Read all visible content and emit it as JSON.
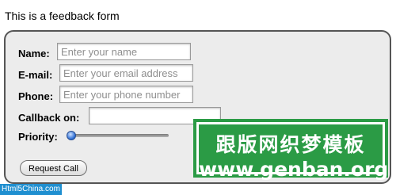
{
  "intro_text": "This is a feedback form",
  "form": {
    "fields": {
      "name": {
        "label": "Name:",
        "placeholder": "Enter your name",
        "value": ""
      },
      "email": {
        "label": "E-mail:",
        "placeholder": "Enter your email address",
        "value": ""
      },
      "phone": {
        "label": "Phone:",
        "placeholder": "Enter your phone number",
        "value": ""
      },
      "callback": {
        "label": "Callback on:",
        "value": ""
      }
    },
    "priority": {
      "label": "Priority:",
      "level": 0
    },
    "submit_label": "Request Call"
  },
  "watermark": {
    "chinese": "跟版网织梦模板",
    "url": "www.genban.org",
    "color": "#2b9b45"
  },
  "corner_mark": "Html5China.com"
}
